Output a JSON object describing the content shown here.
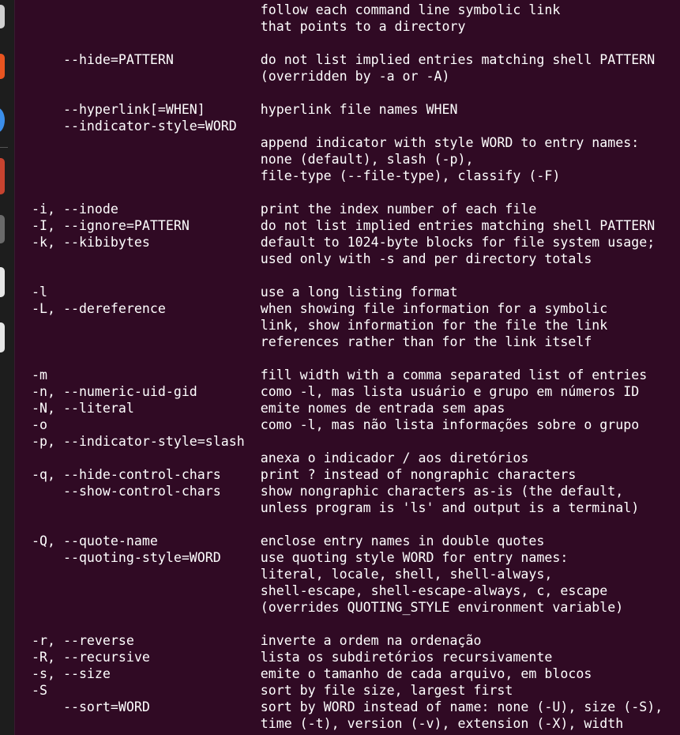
{
  "window": {
    "background": "#300a24",
    "text_color": "#ffffff"
  },
  "dock": {
    "items": [
      {
        "icon": "app-icon-gray",
        "color": "#d0d0d0"
      },
      {
        "icon": "app-icon-orange",
        "color": "#e95420"
      },
      {
        "icon": "app-icon-blue",
        "color": "#3b8eea"
      },
      {
        "icon": "app-icon-red",
        "color": "#c7432f"
      },
      {
        "icon": "app-icon-dark",
        "color": "#6a6a6a"
      },
      {
        "icon": "app-icon-light-1",
        "color": "#e6e6e6"
      },
      {
        "icon": "app-icon-light-2",
        "color": "#e6e6e6"
      }
    ]
  },
  "terminal": {
    "lines": [
      "                             follow each command line symbolic link",
      "                             that points to a directory",
      "",
      "    --hide=PATTERN           do not list implied entries matching shell PATTERN",
      "                             (overridden by -a or -A)",
      "",
      "    --hyperlink[=WHEN]       hyperlink file names WHEN",
      "    --indicator-style=WORD",
      "                             append indicator with style WORD to entry names:",
      "                             none (default), slash (-p),",
      "                             file-type (--file-type), classify (-F)",
      "",
      "-i, --inode                  print the index number of each file",
      "-I, --ignore=PATTERN         do not list implied entries matching shell PATTERN",
      "-k, --kibibytes              default to 1024-byte blocks for file system usage;",
      "                             used only with -s and per directory totals",
      "",
      "-l                           use a long listing format",
      "-L, --dereference            when showing file information for a symbolic",
      "                             link, show information for the file the link",
      "                             references rather than for the link itself",
      "",
      "-m                           fill width with a comma separated list of entries",
      "-n, --numeric-uid-gid        como -l, mas lista usuário e grupo em números ID",
      "-N, --literal                emite nomes de entrada sem apas",
      "-o                           como -l, mas não lista informações sobre o grupo",
      "-p, --indicator-style=slash",
      "                             anexa o indicador / aos diretórios",
      "-q, --hide-control-chars     print ? instead of nongraphic characters",
      "    --show-control-chars     show nongraphic characters as-is (the default,",
      "                             unless program is 'ls' and output is a terminal)",
      "",
      "-Q, --quote-name             enclose entry names in double quotes",
      "    --quoting-style=WORD     use quoting style WORD for entry names:",
      "                             literal, locale, shell, shell-always,",
      "                             shell-escape, shell-escape-always, c, escape",
      "                             (overrides QUOTING_STYLE environment variable)",
      "",
      "-r, --reverse                inverte a ordem na ordenação",
      "-R, --recursive              lista os subdiretórios recursivamente",
      "-s, --size                   emite o tamanho de cada arquivo, em blocos",
      "-S                           sort by file size, largest first",
      "    --sort=WORD              sort by WORD instead of name: none (-U), size (-S),",
      "                             time (-t), version (-v), extension (-X), width"
    ]
  }
}
